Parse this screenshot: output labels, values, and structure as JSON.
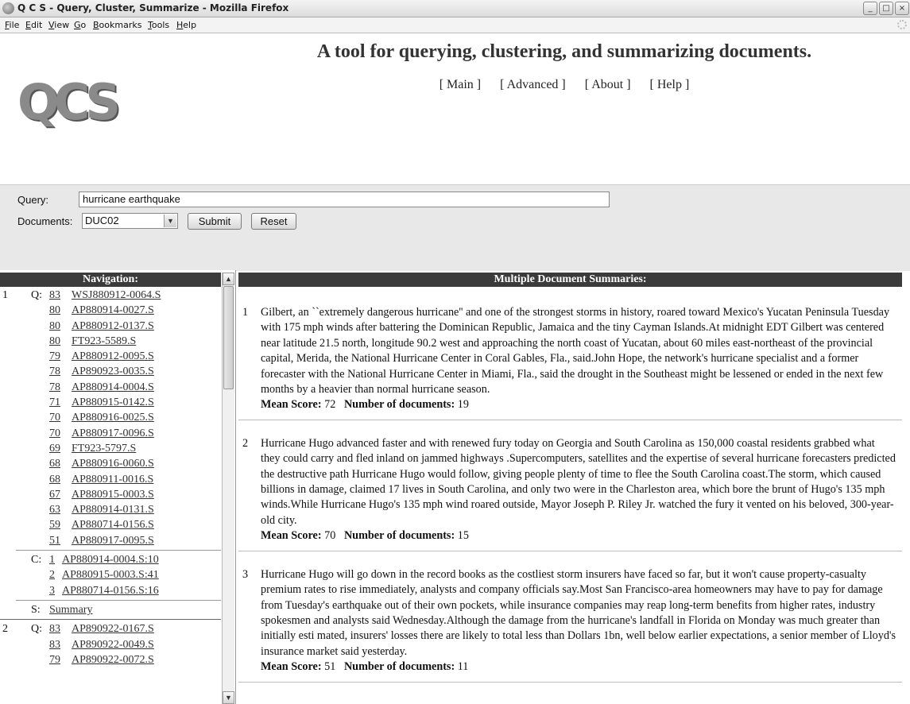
{
  "window": {
    "title": "Q C S - Query, Cluster, Summarize - Mozilla Firefox",
    "controls": [
      "_",
      "□",
      "×"
    ]
  },
  "menu": [
    "File",
    "Edit",
    "View",
    "Go",
    "Bookmarks",
    "Tools",
    "Help"
  ],
  "header": {
    "logo_text": "QCS",
    "tagline": "A tool for querying, clustering, and summarizing documents.",
    "links": [
      "[ Main ]",
      "[ Advanced ]",
      "[ About ]",
      "[ Help ]"
    ]
  },
  "form": {
    "query_label": "Query:",
    "query_value": "hurricane earthquake",
    "documents_label": "Documents:",
    "documents_value": "DUC02",
    "submit_label": "Submit",
    "reset_label": "Reset"
  },
  "navigation": {
    "title": "Navigation:",
    "groups": [
      {
        "number": "1",
        "q_label": "Q:",
        "q_items": [
          {
            "score": "83",
            "doc": "WSJ880912-0064.S"
          },
          {
            "score": "80",
            "doc": "AP880914-0027.S"
          },
          {
            "score": "80",
            "doc": "AP880912-0137.S"
          },
          {
            "score": "80",
            "doc": "FT923-5589.S"
          },
          {
            "score": "79",
            "doc": "AP880912-0095.S"
          },
          {
            "score": "78",
            "doc": "AP890923-0035.S"
          },
          {
            "score": "78",
            "doc": "AP880914-0004.S"
          },
          {
            "score": "71",
            "doc": "AP880915-0142.S"
          },
          {
            "score": "70",
            "doc": "AP880916-0025.S"
          },
          {
            "score": "70",
            "doc": "AP880917-0096.S"
          },
          {
            "score": "69",
            "doc": "FT923-5797.S"
          },
          {
            "score": "68",
            "doc": "AP880916-0060.S"
          },
          {
            "score": "68",
            "doc": "AP880911-0016.S"
          },
          {
            "score": "67",
            "doc": "AP880915-0003.S"
          },
          {
            "score": "63",
            "doc": "AP880914-0131.S"
          },
          {
            "score": "59",
            "doc": "AP880714-0156.S"
          },
          {
            "score": "51",
            "doc": "AP880917-0095.S"
          }
        ],
        "c_label": "C:",
        "c_items": [
          {
            "num": "1",
            "doc": "AP880914-0004.S:10"
          },
          {
            "num": "2",
            "doc": "AP880915-0003.S:41"
          },
          {
            "num": "3",
            "doc": "AP880714-0156.S:16"
          }
        ],
        "s_label": "S:",
        "s_link": "Summary"
      },
      {
        "number": "2",
        "q_label": "Q:",
        "q_items": [
          {
            "score": "83",
            "doc": "AP890922-0167.S"
          },
          {
            "score": "83",
            "doc": "AP890922-0049.S"
          },
          {
            "score": "79",
            "doc": "AP890922-0072.S"
          }
        ]
      }
    ]
  },
  "summaries": {
    "title": "Multiple Document Summaries:",
    "mean_score_label": "Mean Score:",
    "num_docs_label": "Number of documents:",
    "items": [
      {
        "number": "1",
        "text": "Gilbert, an ``extremely dangerous hurricane'' and one of the strongest storms in history, roared toward Mexico's Yucatan Peninsula Tuesday with 175 mph winds after battering the Dominican Republic, Jamaica and the tiny Cayman Islands.At midnight EDT Gilbert was centered near latitude 21.5 north, longitude 90.2 west and approaching the north coast of Yucatan, about 60 miles east-northeast of the provincial capital, Merida, the National Hurricane Center in Coral Gables, Fla., said.John Hope, the network's hurricane specialist and a former forecaster with the National Hurricane Center in Miami, Fla., said the drought in the Southeast might be lessened or ended in the next few months by a heavier than normal hurricane season.",
        "mean_score": "72",
        "num_docs": "19"
      },
      {
        "number": "2",
        "text": "Hurricane Hugo advanced faster and with renewed fury today on Georgia and South Carolina as 150,000 coastal residents grabbed what they could carry and fled inland on jammed highways .Supercomputers, satellites and the expertise of several hurricane forecasters predicted the destructive path Hurricane Hugo would follow, giving people plenty of time to flee the South Carolina coast.The storm, which caused billions in damage, claimed 17 lives in South Carolina, and only two were in the Charleston area, which bore the brunt of Hugo's 135 mph winds.While Hurricane Hugo's 135 mph wind roared outside, Mayor Joseph P. Riley Jr. watched the fury it vented on his beloved, 300-year-old city.",
        "mean_score": "70",
        "num_docs": "15"
      },
      {
        "number": "3",
        "text": "Hurricane Hugo will go down in the record books as the costliest storm insurers have faced so far, but it won't cause property-casualty premium rates to rise immediately, analysts and company officials say.Most San Francisco-area homeowners may have to pay for damage from Tuesday's earthquake out of their own pockets, while insurance companies may reap long-term benefits from higher rates, industry spokesmen and analysts said Wednesday.Although the damage from the hurricane's landfall in Florida on Monday was much greater than initially esti mated, insurers' losses there are likely to total less than Dollars 1bn, well below earlier expectations, a senior member of Lloyd's insurance market said yesterday.",
        "mean_score": "51",
        "num_docs": "11"
      }
    ]
  }
}
